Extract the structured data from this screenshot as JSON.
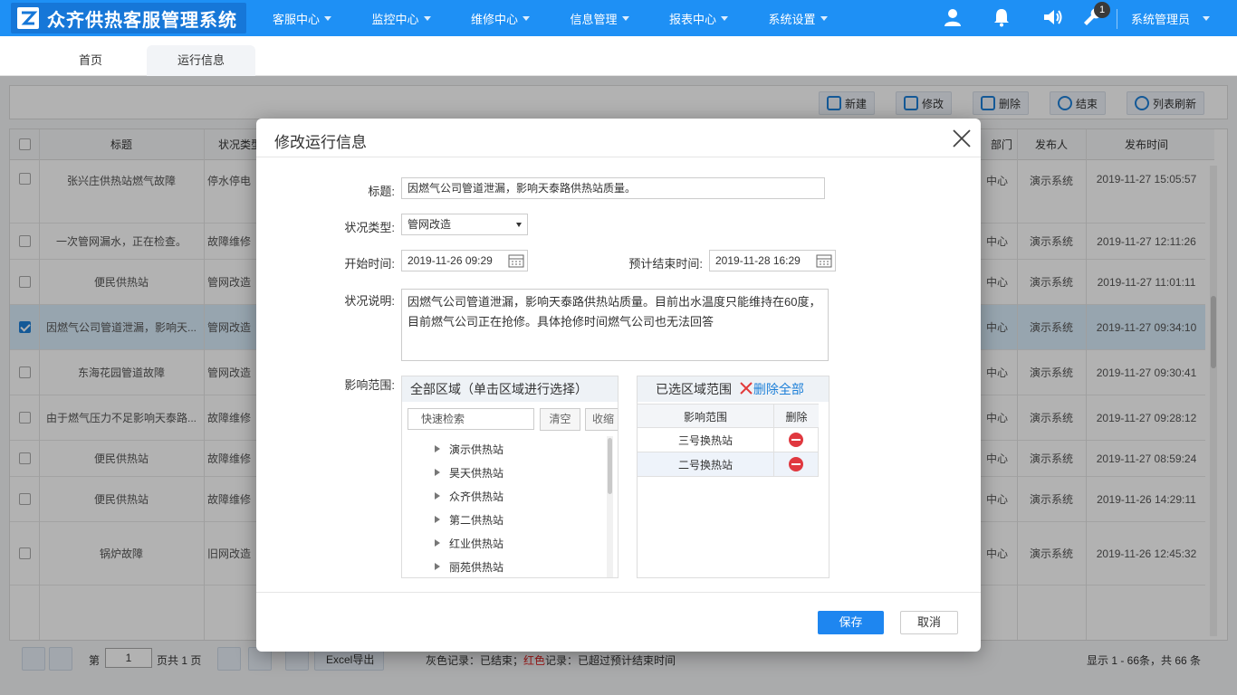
{
  "app": {
    "title": "众齐供热客服管理系统"
  },
  "nav": [
    {
      "label": "客服中心"
    },
    {
      "label": "监控中心"
    },
    {
      "label": "维修中心"
    },
    {
      "label": "信息管理"
    },
    {
      "label": "报表中心"
    },
    {
      "label": "系统设置"
    }
  ],
  "topbar": {
    "notification_count": "1",
    "user_name": "系统管理员"
  },
  "tabs": [
    {
      "label": "首页"
    },
    {
      "label": "运行信息"
    }
  ],
  "toolbar": {
    "new": "新建",
    "edit": "修改",
    "delete": "删除",
    "finish": "结束",
    "refresh": "列表刷新"
  },
  "grid": {
    "columns": {
      "title": "标题",
      "status_type": "状况类型",
      "dept": "部门",
      "publisher": "发布人",
      "publish_time": "发布时间"
    },
    "rows": [
      {
        "title": "张兴庄供热站燃气故障",
        "status_type": "停水停电",
        "dept": "中心",
        "publisher": "演示系统",
        "time": "2019-11-27 15:05:57",
        "checked": false
      },
      {
        "title": "一次管网漏水，正在检查。",
        "status_type": "故障维修",
        "dept": "中心",
        "publisher": "演示系统",
        "time": "2019-11-27 12:11:26",
        "checked": false
      },
      {
        "title": "便民供热站",
        "status_type": "管网改造",
        "dept": "中心",
        "publisher": "演示系统",
        "time": "2019-11-27 11:01:11",
        "checked": false
      },
      {
        "title": "因燃气公司管道泄漏，影响天...",
        "status_type": "管网改造",
        "dept": "中心",
        "publisher": "演示系统",
        "time": "2019-11-27 09:34:10",
        "checked": true
      },
      {
        "title": "东海花园管道故障",
        "status_type": "管网改造",
        "dept": "中心",
        "publisher": "演示系统",
        "time": "2019-11-27 09:30:41",
        "checked": false
      },
      {
        "title": "由于燃气压力不足影响天泰路...",
        "status_type": "故障维修",
        "dept": "中心",
        "publisher": "演示系统",
        "time": "2019-11-27 09:28:12",
        "checked": false
      },
      {
        "title": "便民供热站",
        "status_type": "故障维修",
        "dept": "中心",
        "publisher": "演示系统",
        "time": "2019-11-27 08:59:24",
        "checked": false
      },
      {
        "title": "便民供热站",
        "status_type": "故障维修",
        "dept": "中心",
        "publisher": "演示系统",
        "time": "2019-11-26 14:29:11",
        "checked": false
      },
      {
        "title": "锅炉故障",
        "status_type": "旧网改造",
        "dept": "中心",
        "publisher": "演示系统",
        "time": "2019-11-26 12:45:32",
        "checked": false
      }
    ]
  },
  "pager": {
    "page_prefix": "第",
    "page": "1",
    "page_suffix": "页共 1 页",
    "excel": "Excel导出",
    "legend_gray": "灰色",
    "legend_gray_text": "记录：已结束；",
    "legend_red": "红色",
    "legend_red_text": "记录：已超过预计结束时间",
    "summary": "显示 1 - 66条，共 66 条"
  },
  "dialog": {
    "title": "修改运行信息",
    "title_label": "标题:",
    "title_value": "因燃气公司管道泄漏，影响天泰路供热站质量。",
    "status_type_label": "状况类型:",
    "status_type_value": "管网改造",
    "start_time_label": "开始时间:",
    "start_time_value": "2019-11-26 09:29",
    "end_time_label": "预计结束时间:",
    "end_time_value": "2019-11-28 16:29",
    "description_label": "状况说明:",
    "description_value": "因燃气公司管道泄漏，影响天泰路供热站质量。目前出水温度只能维持在60度，目前燃气公司正在抢修。具体抢修时间燃气公司也无法回答",
    "scope_label": "影响范围:",
    "all_regions_header": "全部区域（单击区域进行选择）",
    "search_placeholder": "快速检索",
    "clear_button": "清空",
    "collapse_button": "收缩",
    "tree_items": [
      {
        "label": "演示供热站"
      },
      {
        "label": "昊天供热站"
      },
      {
        "label": "众齐供热站"
      },
      {
        "label": "第二供热站"
      },
      {
        "label": "红业供热站"
      },
      {
        "label": "丽苑供热站"
      }
    ],
    "selected_header": "已选区域范围",
    "delete_all": "删除全部",
    "selected_col_scope": "影响范围",
    "selected_col_delete": "删除",
    "selected_items": [
      {
        "label": "三号换热站"
      },
      {
        "label": "二号换热站"
      }
    ],
    "save": "保存",
    "cancel": "取消"
  }
}
